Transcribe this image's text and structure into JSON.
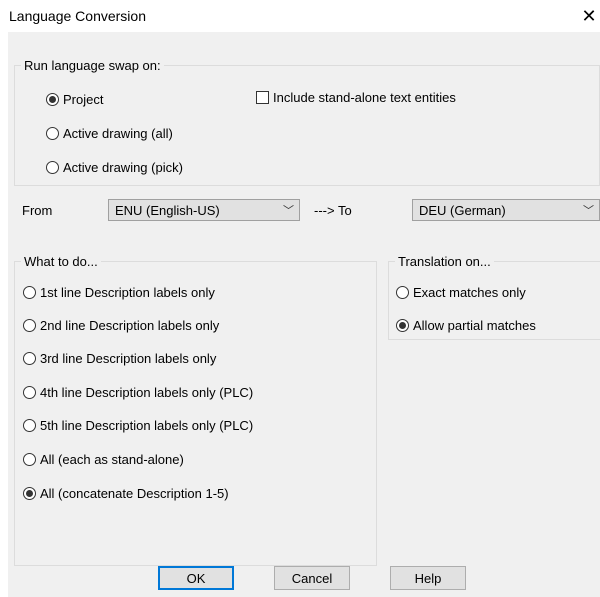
{
  "window": {
    "title": "Language Conversion",
    "close_glyph": "✕"
  },
  "run_group": {
    "legend": "Run language swap on:",
    "options": [
      {
        "label": "Project",
        "selected": true
      },
      {
        "label": "Active drawing (all)",
        "selected": false
      },
      {
        "label": "Active drawing (pick)",
        "selected": false
      }
    ],
    "include_checkbox": {
      "label": "Include stand-alone text entities",
      "checked": false
    }
  },
  "language": {
    "from_label": "From",
    "from_value": "ENU (English-US)",
    "to_label": "---> To",
    "to_value": "DEU (German)"
  },
  "what_group": {
    "legend": "What to do...",
    "options": [
      {
        "label": "1st line Description labels only",
        "selected": false
      },
      {
        "label": "2nd line Description labels only",
        "selected": false
      },
      {
        "label": "3rd line Description labels only",
        "selected": false
      },
      {
        "label": "4th line Description labels only (PLC)",
        "selected": false
      },
      {
        "label": "5th line Description labels only (PLC)",
        "selected": false
      },
      {
        "label": "All (each as stand-alone)",
        "selected": false
      },
      {
        "label": "All (concatenate Description 1-5)",
        "selected": true
      }
    ]
  },
  "translation_group": {
    "legend": "Translation on...",
    "options": [
      {
        "label": "Exact matches only",
        "selected": false
      },
      {
        "label": "Allow partial matches",
        "selected": true
      }
    ]
  },
  "buttons": {
    "ok": "OK",
    "cancel": "Cancel",
    "help": "Help"
  },
  "icons": {
    "close": "close-icon",
    "dropdown": "chevron-down-icon"
  }
}
